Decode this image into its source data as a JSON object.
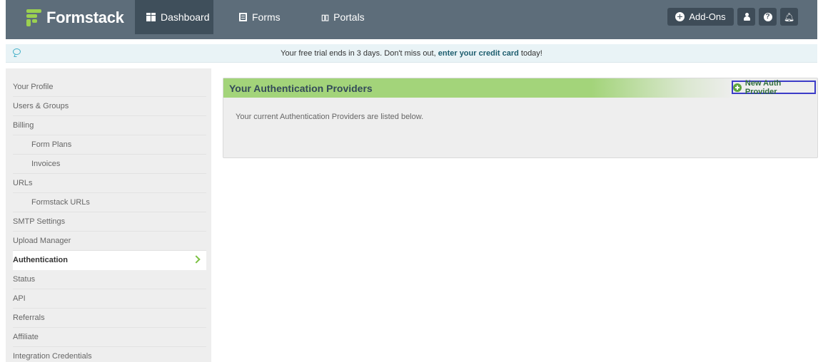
{
  "header": {
    "brand": "Formstack",
    "tabs": [
      {
        "label": "Dashboard",
        "icon": "dashboard-icon",
        "active": true
      },
      {
        "label": "Forms",
        "icon": "forms-icon",
        "active": false
      },
      {
        "label": "Portals",
        "icon": "portals-icon",
        "active": false
      }
    ],
    "addons_label": "Add-Ons",
    "icons": [
      "user-icon",
      "help-icon",
      "bell-icon"
    ],
    "portals_glyph": "▯▯"
  },
  "banner": {
    "text_before": "Your free trial ends in 3 days. Don't miss out,",
    "link_text": "enter your credit card",
    "text_after": "today!"
  },
  "sidebar": {
    "items": [
      {
        "label": "Your Profile",
        "sub": false,
        "active": false
      },
      {
        "label": "Users & Groups",
        "sub": false,
        "active": false
      },
      {
        "label": "Billing",
        "sub": false,
        "active": false
      },
      {
        "label": "Form Plans",
        "sub": true,
        "active": false
      },
      {
        "label": "Invoices",
        "sub": true,
        "active": false
      },
      {
        "label": "URLs",
        "sub": false,
        "active": false
      },
      {
        "label": "Formstack URLs",
        "sub": true,
        "active": false
      },
      {
        "label": "SMTP Settings",
        "sub": false,
        "active": false
      },
      {
        "label": "Upload Manager",
        "sub": false,
        "active": false
      },
      {
        "label": "Authentication",
        "sub": false,
        "active": true
      },
      {
        "label": "Status",
        "sub": false,
        "active": false
      },
      {
        "label": "API",
        "sub": false,
        "active": false
      },
      {
        "label": "Referrals",
        "sub": false,
        "active": false
      },
      {
        "label": "Affiliate",
        "sub": false,
        "active": false
      },
      {
        "label": "Integration Credentials",
        "sub": false,
        "active": false
      }
    ]
  },
  "main": {
    "panel_title": "Your Authentication Providers",
    "new_button_label": "New Auth Provider",
    "description": "Your current Authentication Providers are listed below."
  },
  "colors": {
    "nav_bg": "#5d6d7a",
    "accent_green": "#9bd050",
    "banner_bg": "#e9f3f6"
  }
}
